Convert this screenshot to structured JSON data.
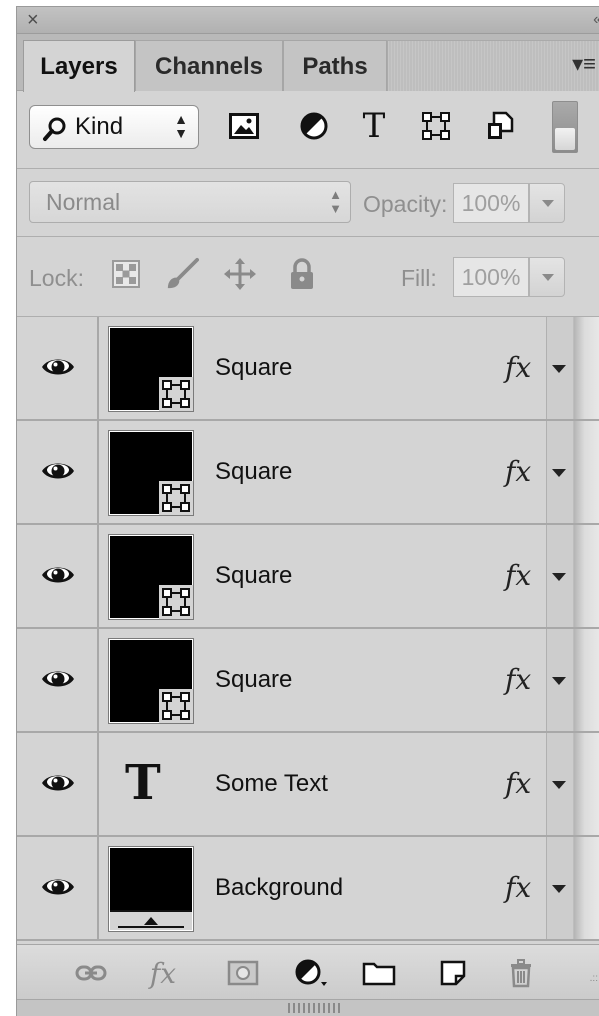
{
  "panel": {
    "close_glyph": "×",
    "collapse_glyph": "«",
    "menu_glyph": "▾≡"
  },
  "tabs": [
    {
      "label": "Layers",
      "active": true
    },
    {
      "label": "Channels",
      "active": false
    },
    {
      "label": "Paths",
      "active": false
    }
  ],
  "filter": {
    "kind_label": "Kind",
    "icons": [
      "image-filter-icon",
      "adjustment-filter-icon",
      "type-filter-icon",
      "shape-filter-icon",
      "smart-object-filter-icon"
    ],
    "type_glyph": "T"
  },
  "blend": {
    "mode": "Normal",
    "opacity_label": "Opacity:",
    "opacity_value": "100%"
  },
  "lock": {
    "label": "Lock:",
    "fill_label": "Fill:",
    "fill_value": "100%"
  },
  "layers": [
    {
      "name": "Square",
      "kind": "shape",
      "visible": true,
      "fx": "fx"
    },
    {
      "name": "Square",
      "kind": "shape",
      "visible": true,
      "fx": "fx"
    },
    {
      "name": "Square",
      "kind": "shape",
      "visible": true,
      "fx": "fx"
    },
    {
      "name": "Square",
      "kind": "shape",
      "visible": true,
      "fx": "fx"
    },
    {
      "name": "Some Text",
      "kind": "text",
      "visible": true,
      "fx": "fx",
      "type_glyph": "T"
    },
    {
      "name": "Background",
      "kind": "background",
      "visible": true,
      "fx": "fx"
    }
  ],
  "bottom": {
    "fx_glyph": "fx"
  }
}
